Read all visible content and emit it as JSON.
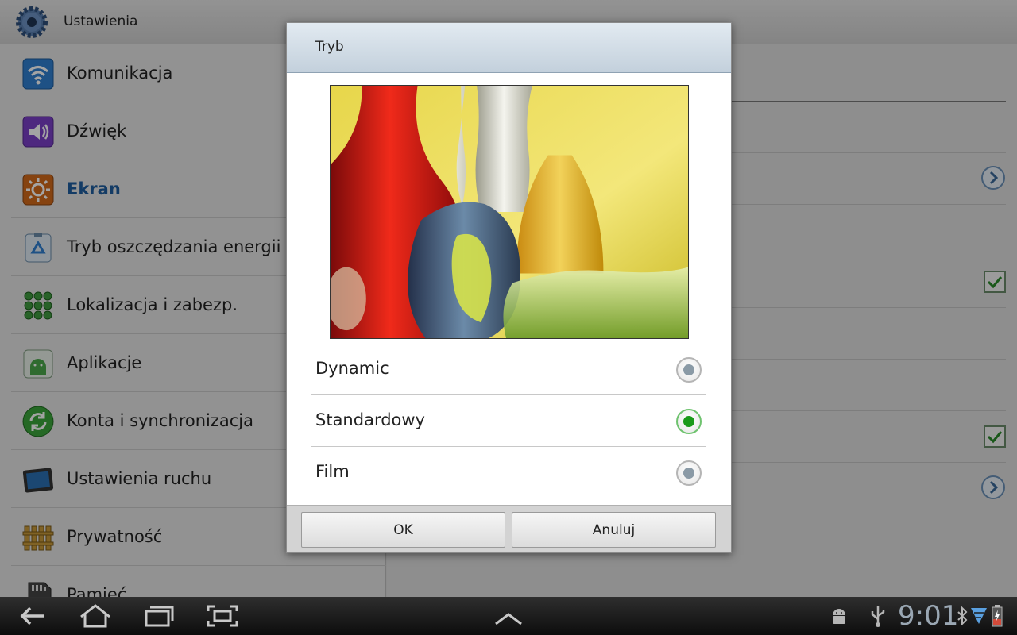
{
  "app": {
    "title": "Ustawienia"
  },
  "menu": [
    {
      "label": "Komunikacja",
      "icon": "wifi-icon",
      "color": "#2f7fd0"
    },
    {
      "label": "Dźwięk",
      "icon": "speaker-icon",
      "color": "#7a3fc7"
    },
    {
      "label": "Ekran",
      "icon": "brightness-icon",
      "color": "#d26a1a",
      "active": true
    },
    {
      "label": "Tryb oszczędzania energii",
      "icon": "recycle-icon",
      "color": "#3a8fd0"
    },
    {
      "label": "Lokalizacja i zabezp.",
      "icon": "grid-dots-icon",
      "color": "#3f9a3f"
    },
    {
      "label": "Aplikacje",
      "icon": "android-apps-icon",
      "color": "#4aa84a"
    },
    {
      "label": "Konta i synchronizacja",
      "icon": "sync-icon",
      "color": "#3aa43a"
    },
    {
      "label": "Ustawienia ruchu",
      "icon": "tablet-motion-icon",
      "color": "#2b6fb3"
    },
    {
      "label": "Prywatność",
      "icon": "fence-icon",
      "color": "#b58a2a"
    },
    {
      "label": "Pamięć",
      "icon": "sd-card-icon",
      "color": "#444444"
    }
  ],
  "dialog": {
    "title": "Tryb",
    "options": [
      {
        "label": "Dynamic",
        "selected": false
      },
      {
        "label": "Standardowy",
        "selected": true
      },
      {
        "label": "Film",
        "selected": false
      }
    ],
    "ok_label": "OK",
    "cancel_label": "Anuluj"
  },
  "statusbar": {
    "time": "9:01",
    "icons": [
      "android-debug-icon",
      "usb-icon",
      "bluetooth-icon",
      "signal-icon",
      "battery-charging-icon"
    ]
  },
  "colors": {
    "accent": "#1f5d9e",
    "radio_selected": "#1a9a1a",
    "check": "#2a8a2a"
  }
}
